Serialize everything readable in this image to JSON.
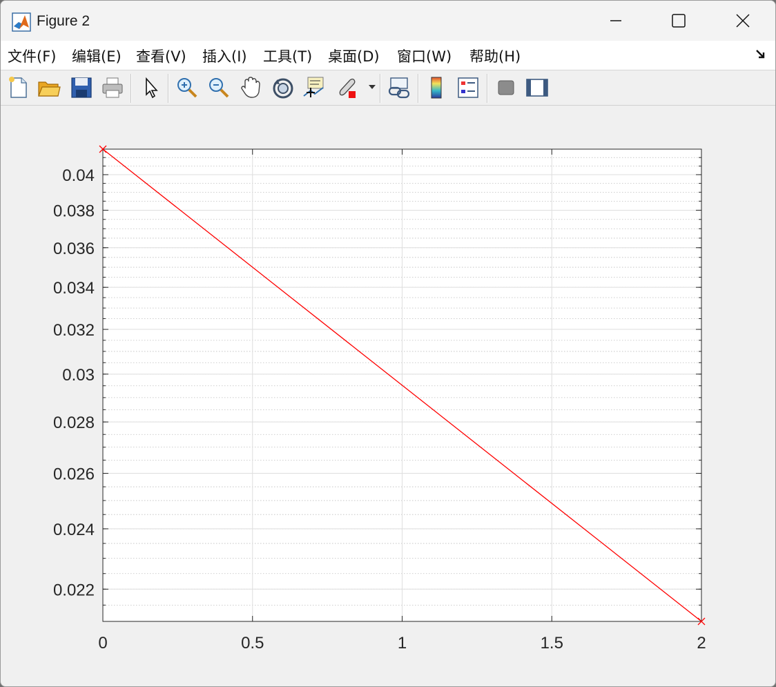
{
  "window": {
    "title": "Figure 2"
  },
  "menus": [
    "文件(F)",
    "编辑(E)",
    "查看(V)",
    "插入(I)",
    "工具(T)",
    "桌面(D)",
    "窗口(W)",
    "帮助(H)"
  ],
  "toolbar": {
    "icons": [
      "new-figure-icon",
      "open-file-icon",
      "save-icon",
      "print-icon",
      "edit-plot-icon",
      "zoom-in-icon",
      "zoom-out-icon",
      "pan-icon",
      "rotate-3d-icon",
      "data-cursor-icon",
      "brush-icon",
      "link-plot-icon",
      "colorbar-icon",
      "legend-icon",
      "hide-plot-tools-icon",
      "show-plot-tools-icon"
    ]
  },
  "chart_data": {
    "type": "line",
    "title": "",
    "xlabel": "",
    "ylabel": "",
    "y_scale": "log",
    "xlim": [
      0,
      2
    ],
    "ylim": [
      0.021,
      0.0415
    ],
    "xticks": [
      "0",
      "0.5",
      "1",
      "1.5",
      "2"
    ],
    "yticks": [
      "0.022",
      "0.024",
      "0.026",
      "0.028",
      "0.03",
      "0.032",
      "0.034",
      "0.036",
      "0.038",
      "0.04"
    ],
    "grid": true,
    "minor_grid": true,
    "series": [
      {
        "color": "#ff0000",
        "marker": "x",
        "x": [
          0,
          2
        ],
        "y": [
          0.0415,
          0.021
        ]
      }
    ]
  }
}
